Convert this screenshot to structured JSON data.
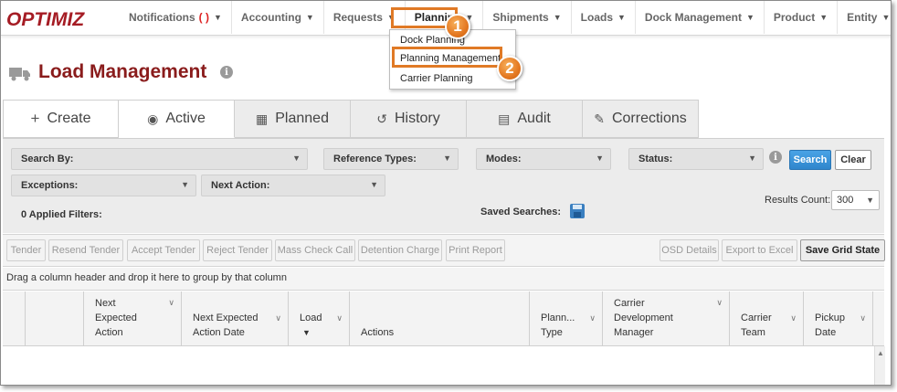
{
  "app": {
    "logo": "OPTIMIZ"
  },
  "nav": {
    "items": [
      {
        "label": "Notifications",
        "extra": "( )"
      },
      {
        "label": "Accounting"
      },
      {
        "label": "Requests"
      },
      {
        "label": "Planning"
      },
      {
        "label": "Shipments"
      },
      {
        "label": "Loads"
      },
      {
        "label": "Dock Management"
      },
      {
        "label": "Product"
      },
      {
        "label": "Entity"
      }
    ],
    "caret": "▼"
  },
  "dropdown": {
    "items": [
      "Dock Planning",
      "Planning Management",
      "Carrier Planning"
    ]
  },
  "callouts": [
    "1",
    "2"
  ],
  "header": {
    "title": "Load Management"
  },
  "tabs": [
    {
      "label": "Create",
      "icon": "+"
    },
    {
      "label": "Active",
      "icon": "◉"
    },
    {
      "label": "Planned",
      "icon": "▦"
    },
    {
      "label": "History",
      "icon": "↺"
    },
    {
      "label": "Audit",
      "icon": "▤"
    },
    {
      "label": "Corrections",
      "icon": "✎"
    }
  ],
  "filters": {
    "search_by": "Search By:",
    "reference_types": "Reference Types:",
    "modes": "Modes:",
    "status": "Status:",
    "exceptions": "Exceptions:",
    "next_action": "Next Action:",
    "search_button": "Search",
    "clear_button": "Clear",
    "applied_filters": "0 Applied Filters:",
    "saved_searches": "Saved Searches:",
    "results_count_label": "Results Count:",
    "results_count_value": "300"
  },
  "actions": {
    "tender": "Tender",
    "resend_tender": "Resend Tender",
    "accept_tender": "Accept Tender",
    "reject_tender": "Reject Tender",
    "mass_check_call": "Mass Check Call",
    "detention_charge": "Detention Charge",
    "print_report": "Print Report",
    "osd_details": "OSD Details",
    "export_to_excel": "Export to Excel",
    "save_grid_state": "Save Grid State"
  },
  "grid": {
    "group_hint": "Drag a column header and drop it here to group by that column",
    "columns": [
      {
        "label": ""
      },
      {
        "label": ""
      },
      {
        "line1": "Next",
        "line2": "Expected",
        "line3": "Action"
      },
      {
        "line1": "",
        "line2": "Next Expected",
        "line3": "Action Date"
      },
      {
        "line1": "",
        "line2": "Load",
        "line3": "▼"
      },
      {
        "line1": "",
        "line2": "",
        "line3": "Actions"
      },
      {
        "line1": "",
        "line2": "Plann...",
        "line3": "Type"
      },
      {
        "line1": "Carrier",
        "line2": "Development",
        "line3": "Manager"
      },
      {
        "line1": "",
        "line2": "Carrier",
        "line3": "Team"
      },
      {
        "line1": "",
        "line2": "Pickup",
        "line3": "Date"
      }
    ]
  }
}
